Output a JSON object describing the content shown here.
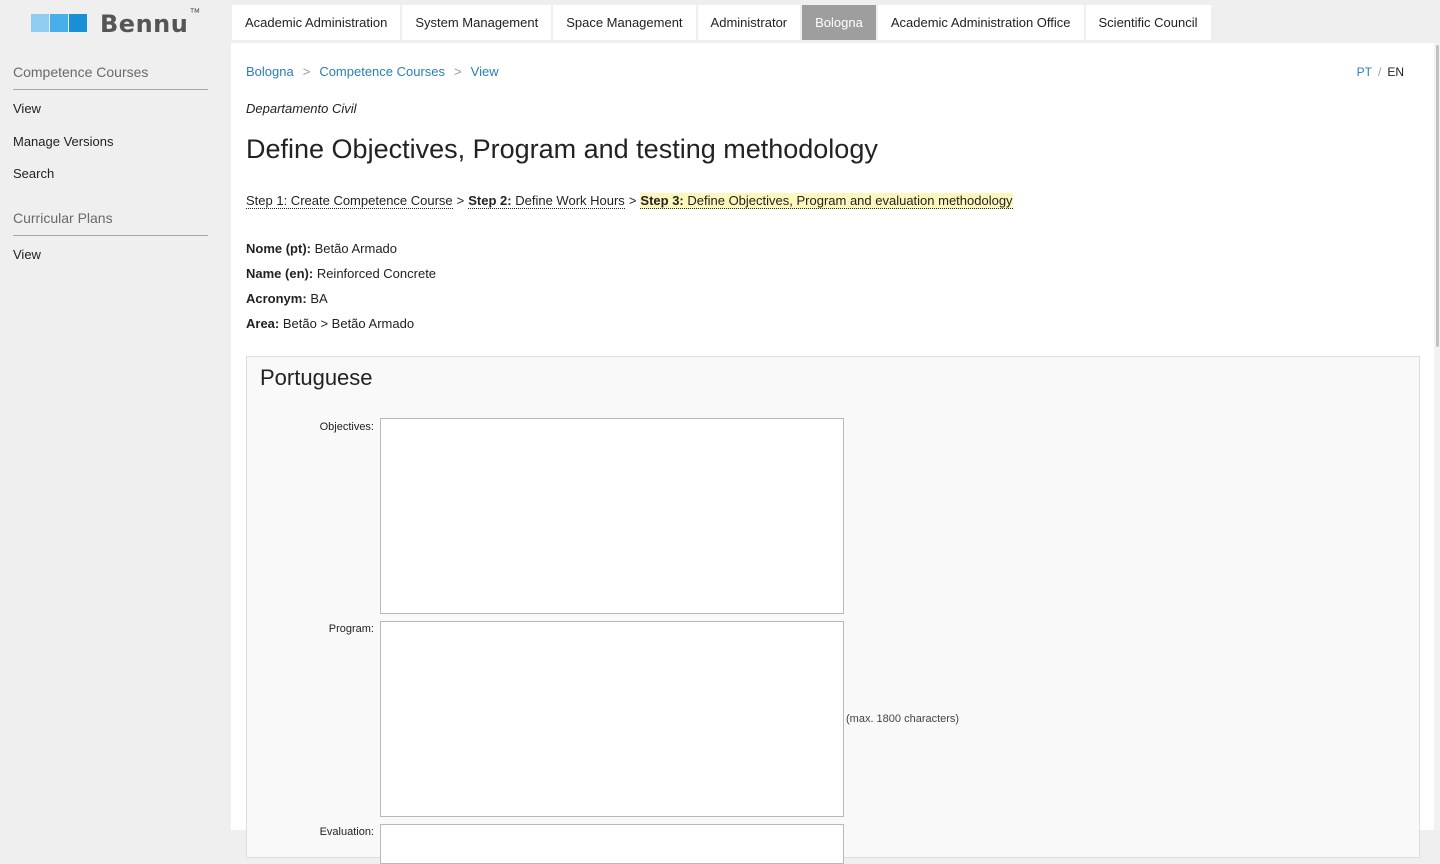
{
  "brand": {
    "name": "Bennu",
    "tm": "™",
    "colors": [
      "#8ecdf0",
      "#46aee8",
      "#1a8fd6"
    ]
  },
  "sidebar": {
    "sections": [
      {
        "title": "Competence Courses",
        "items": [
          "View",
          "Manage Versions",
          "Search"
        ]
      },
      {
        "title": "Curricular Plans",
        "items": [
          "View"
        ]
      }
    ]
  },
  "topnav": {
    "tabs": [
      "Academic Administration",
      "System Management",
      "Space Management",
      "Administrator",
      "Bologna",
      "Academic Administration Office",
      "Scientific Council"
    ],
    "active": "Bologna"
  },
  "breadcrumb": {
    "items": [
      "Bologna",
      "Competence Courses",
      "View"
    ],
    "separator": ">"
  },
  "language": {
    "pt": "PT",
    "separator": "/",
    "en": "EN",
    "current": "EN"
  },
  "department": "Departamento Civil",
  "page_title": "Define Objectives, Program and testing methodology",
  "steps": {
    "step1": "Step 1: Create Competence Course",
    "arrow": ">",
    "step2_bold": "Step 2:",
    "step2_text": "Define Work Hours",
    "step3_bold": "Step 3:",
    "step3_text": "Define Objectives, Program and evaluation methodology"
  },
  "course": {
    "name_pt_label": "Nome (pt):",
    "name_pt": "Betão Armado",
    "name_en_label": "Name (en):",
    "name_en": "Reinforced Concrete",
    "acronym_label": "Acronym:",
    "acronym": "BA",
    "area_label": "Area:",
    "area": "Betão > Betão Armado"
  },
  "portuguese": {
    "title": "Portuguese",
    "objectives_label": "Objectives:",
    "objectives_value": "",
    "program_label": "Program:",
    "program_value": "",
    "program_hint": "(max. 1800 characters)",
    "evaluation_label": "Evaluation:"
  },
  "colors": {
    "link": "#2a7fb5",
    "active_tab": "#9e9e9e",
    "highlight": "#fdf6bd"
  }
}
